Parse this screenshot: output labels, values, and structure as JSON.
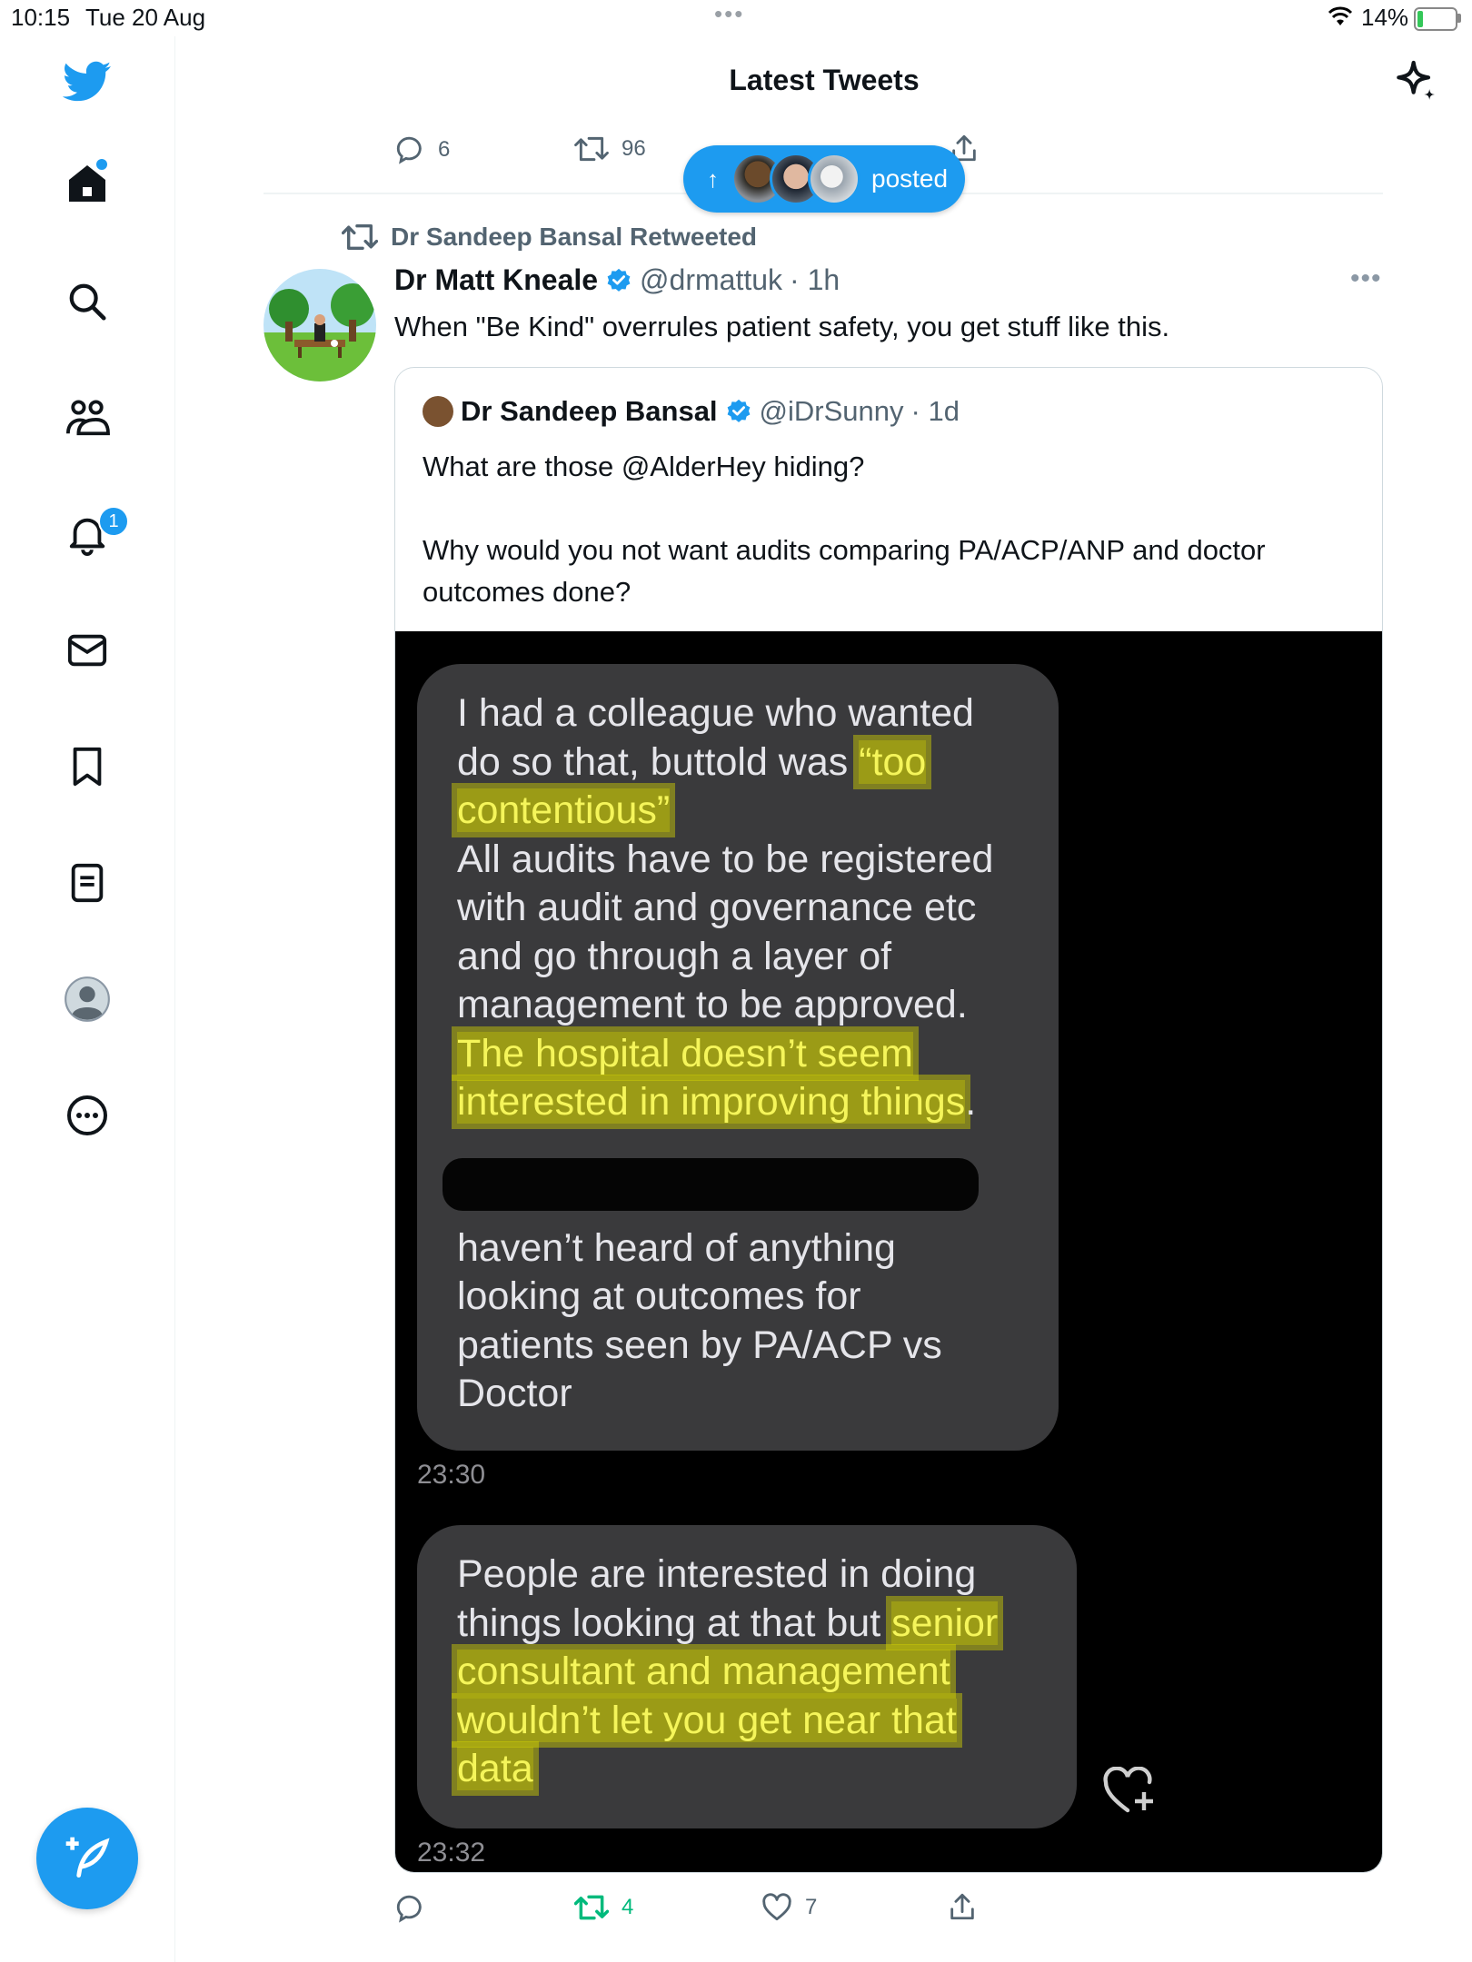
{
  "status_bar": {
    "time": "10:15",
    "date": "Tue 20 Aug",
    "battery": "14%"
  },
  "header": {
    "title": "Latest Tweets"
  },
  "prev_tweet_actions": {
    "replies": "6",
    "retweets": "96"
  },
  "posted_pill": {
    "label": "posted"
  },
  "notifications_badge": "1",
  "retweet_header": "Dr Sandeep Bansal Retweeted",
  "tweet": {
    "name": "Dr Matt Kneale",
    "handle": "@drmattuk",
    "time": "· 1h",
    "text": "When \"Be Kind\" overrules patient safety, you get stuff like this."
  },
  "quote": {
    "name": "Dr Sandeep Bansal",
    "handle": "@iDrSunny",
    "time": "· 1d",
    "text": "What are those @AlderHey hiding?\n\nWhy would you not want audits comparing PA/ACP/ANP and doctor outcomes done?"
  },
  "chat": {
    "m1_l1": "I had a colleague who wanted",
    "m1_l2a": "do so that, buttold was ",
    "m1_l2b": "“too",
    "m1_l3": "contentious”",
    "m1_l4": "All audits have to be registered",
    "m1_l5": "with audit and governance etc",
    "m1_l6": "and go through a layer of",
    "m1_l7": "management to be approved.",
    "m1_l8": "The hospital doesn’t seem",
    "m1_l9a": "interested in improving things",
    "m1_l9b": ".",
    "m1_l10": "haven’t heard of anything",
    "m1_l11": "looking at outcomes for",
    "m1_l12": "patients seen by PA/ACP vs",
    "m1_l13": "Doctor",
    "time1": "23:30",
    "m2_l1": "People are  interested in doing",
    "m2_l2a": "things looking at that but ",
    "m2_l2b": "senior",
    "m2_l3": "consultant and management",
    "m2_l4": "wouldn’t let you get near that",
    "m2_l5": "data",
    "time2": "23:32"
  },
  "tweet_actions": {
    "retweets": "4",
    "likes": "7"
  },
  "colors": {
    "accent": "#1d9bf0",
    "retweet_green": "#00ba7c",
    "highlight": "#d6d600"
  }
}
